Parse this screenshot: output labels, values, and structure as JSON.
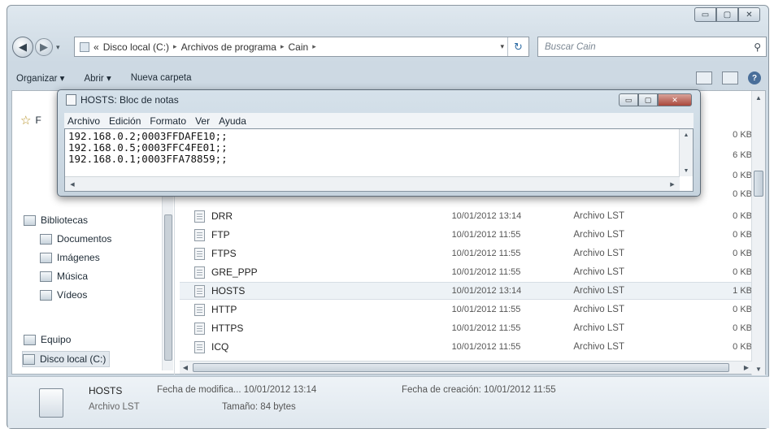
{
  "explorer": {
    "caption_buttons": {
      "minimize": "▭",
      "maximize": "▢",
      "close": "✕"
    },
    "nav": {
      "back": "◀",
      "forward": "▶",
      "history_drop": "▾"
    },
    "address": {
      "root": "«",
      "crumbs": [
        "Disco local (C:)",
        "Archivos de programa",
        "Cain"
      ],
      "sep": "▸",
      "drop": "▾",
      "refresh": "↻"
    },
    "search": {
      "placeholder": "Buscar Cain",
      "icon": "⚲"
    },
    "toolbar": {
      "organize": "Organizar ▾",
      "open": "Abrir ▾",
      "new_folder": "Nueva carpeta",
      "help": "?"
    },
    "sidebar": {
      "favorites_label": "F",
      "libraries": "Bibliotecas",
      "documents": "Documentos",
      "images": "Imágenes",
      "music": "Música",
      "videos": "Vídeos",
      "computer": "Equipo",
      "local_disk": "Disco local (C:)"
    },
    "top_sizes": [
      "0 KB",
      "6 KB",
      "0 KB",
      "0 KB"
    ],
    "files": [
      {
        "name": "DRR",
        "date": "10/01/2012 13:14",
        "type": "Archivo LST",
        "size": "0 KB"
      },
      {
        "name": "FTP",
        "date": "10/01/2012 11:55",
        "type": "Archivo LST",
        "size": "0 KB"
      },
      {
        "name": "FTPS",
        "date": "10/01/2012 11:55",
        "type": "Archivo LST",
        "size": "0 KB"
      },
      {
        "name": "GRE_PPP",
        "date": "10/01/2012 11:55",
        "type": "Archivo LST",
        "size": "0 KB"
      },
      {
        "name": "HOSTS",
        "date": "10/01/2012 13:14",
        "type": "Archivo LST",
        "size": "1 KB"
      },
      {
        "name": "HTTP",
        "date": "10/01/2012 11:55",
        "type": "Archivo LST",
        "size": "0 KB"
      },
      {
        "name": "HTTPS",
        "date": "10/01/2012 11:55",
        "type": "Archivo LST",
        "size": "0 KB"
      },
      {
        "name": "ICQ",
        "date": "10/01/2012 11:55",
        "type": "Archivo LST",
        "size": "0 KB"
      }
    ],
    "details": {
      "name": "HOSTS",
      "type": "Archivo LST",
      "modified": "Fecha de modifica... 10/01/2012 13:14",
      "size": "Tamaño: 84 bytes",
      "created": "Fecha de creación: 10/01/2012 11:55"
    }
  },
  "notepad": {
    "title": "HOSTS: Bloc de notas",
    "menu": [
      "Archivo",
      "Edición",
      "Formato",
      "Ver",
      "Ayuda"
    ],
    "lines": [
      "192.168.0.2;0003FFDAFE10;;",
      "192.168.0.5;0003FFC4FE01;;",
      "192.168.0.1;0003FFA78859;;"
    ],
    "buttons": {
      "minimize": "▭",
      "maximize": "▢",
      "close": "✕"
    }
  }
}
